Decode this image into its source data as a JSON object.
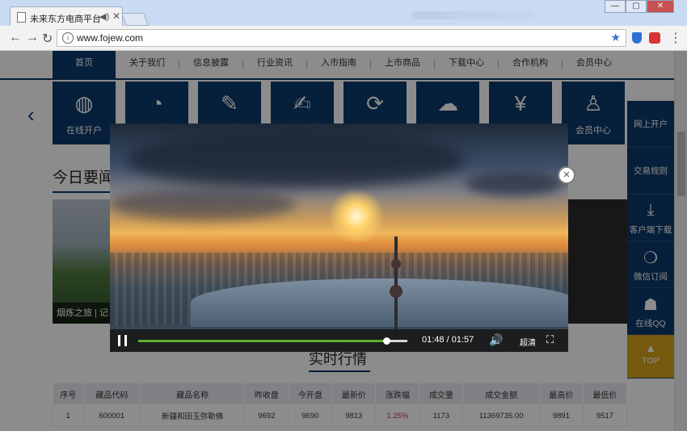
{
  "browser": {
    "tab_title": "未来东方电商平台",
    "url": "www.fojew.com",
    "window_buttons": [
      "—",
      "▢",
      "✕"
    ]
  },
  "nav": {
    "items": [
      "首页",
      "关于我们",
      "信息披露",
      "行业资讯",
      "入市指南",
      "上市商品",
      "下载中心",
      "合作机构",
      "会员中心"
    ]
  },
  "tiles": {
    "first_label": "在线开户",
    "last_label": "会员中心"
  },
  "news": {
    "title": "今日要闻",
    "caption": "烟炼之旅 | 记"
  },
  "side": {
    "items": [
      "网上开户",
      "交易规则",
      "客户端下载",
      "微信订阅",
      "在线QQ",
      "TOP"
    ]
  },
  "quotes": {
    "title": "实时行情",
    "columns": [
      "序号",
      "藏品代码",
      "藏品名称",
      "昨收盘",
      "今开盘",
      "最新价",
      "涨跌幅",
      "成交量",
      "成交金额",
      "最高价",
      "最低价"
    ],
    "rows": [
      [
        "1",
        "600001",
        "新疆和田玉弥勒佛",
        "9692",
        "9690",
        "9813",
        "1.25%",
        "1173",
        "11369735.00",
        "9891",
        "9517"
      ]
    ],
    "change_color": "#d23a3a"
  },
  "video": {
    "time_current": "01:48",
    "time_total": "01:57",
    "time_separator": "/",
    "progress": 0.923,
    "quality": "超清"
  },
  "colors": {
    "brand": "#0c3a6b",
    "top_button": "#d9a31a",
    "progress": "#58b02f"
  }
}
